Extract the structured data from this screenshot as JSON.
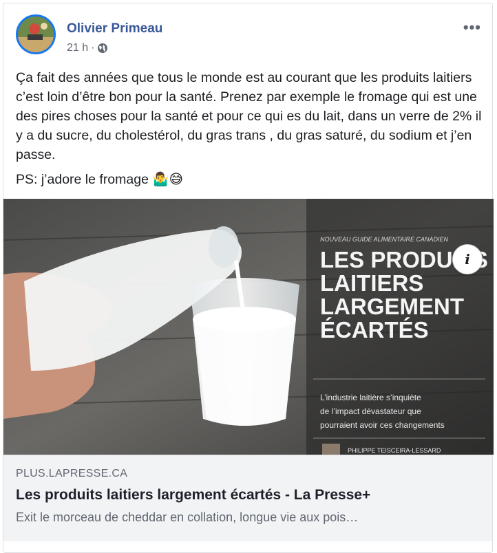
{
  "post": {
    "author": "Olivier Primeau",
    "time": "21 h",
    "separator": "·",
    "more_label": "•••",
    "text_main": "Ça fait des années que tous le monde est au courant que les produits laitiers c’est loin d’être bon pour la santé. Prenez par exemple le fromage qui est une des pires choses pour la santé et pour ce qui es du lait, dans un verre de 2% il y a du sucre, du cholestérol, du gras trans , du gras saturé, du sodium et j’en passe.",
    "text_ps": "PS: j’adore le fromage",
    "ps_emojis": "🤷‍♂️😅"
  },
  "image": {
    "kicker": "NOUVEAU GUIDE ALIMENTAIRE CANADIEN",
    "headline_lines": [
      "LES PRODUITS",
      "LAITIERS",
      "LARGEMENT",
      "ÉCARTÉS"
    ],
    "deck_lines": [
      "L’industrie laitière s’inquiète",
      "de l’impact dévastateur que",
      "pourraient avoir ces changements"
    ],
    "byline": "PHILIPPE TEISCEIRA-LESSARD"
  },
  "info_button": "i",
  "link": {
    "domain": "PLUS.LAPRESSE.CA",
    "title": "Les produits laitiers largement écartés - La Presse+",
    "description": "Exit le morceau de cheddar en collation, longue vie aux pois…"
  },
  "colors": {
    "author_blue": "#385898",
    "avatar_ring": "#1877f2",
    "link_bg": "#f2f3f5"
  }
}
